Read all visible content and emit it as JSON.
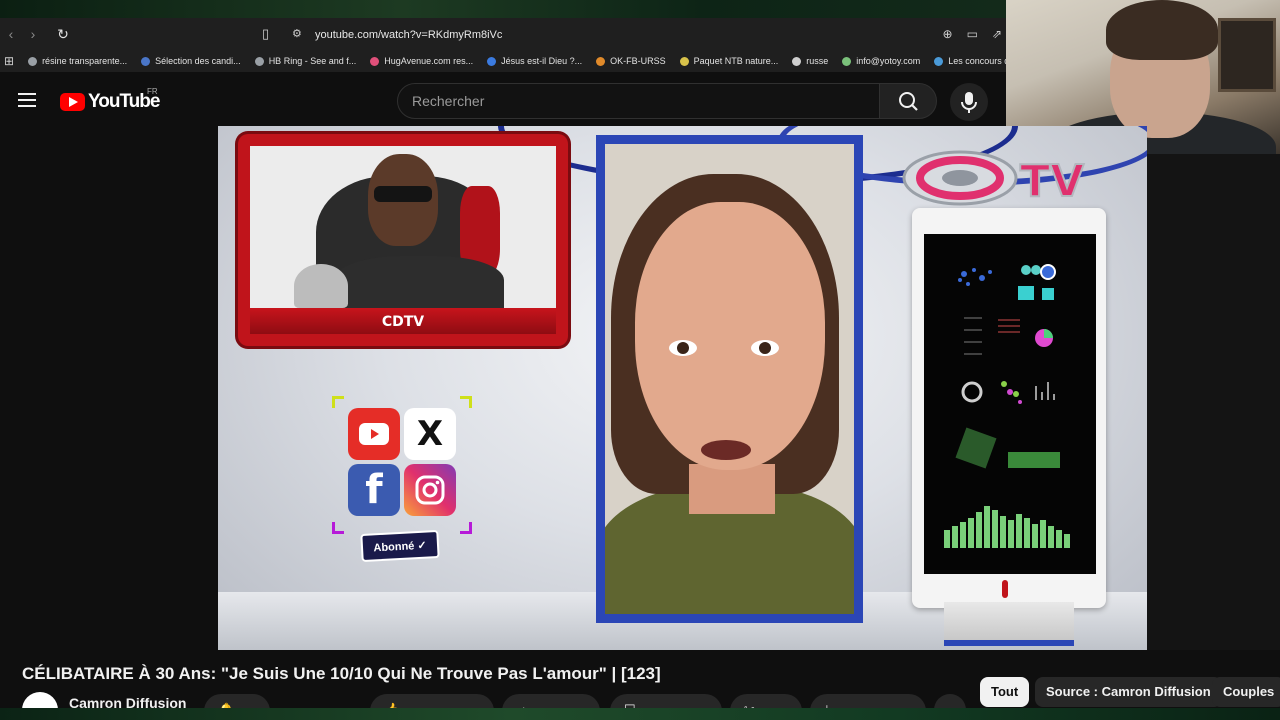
{
  "browser": {
    "url": "youtube.com/watch?v=RKdmyRm8iVc",
    "bookmarks": [
      {
        "label": "résine transparente...",
        "color": "#9aa0a6"
      },
      {
        "label": "Sélection des candi...",
        "color": "#4a76c8"
      },
      {
        "label": "HB Ring - See and f...",
        "color": "#9aa0a6"
      },
      {
        "label": "HugAvenue.com res...",
        "color": "#e0507a"
      },
      {
        "label": "Jésus est-il Dieu ?...",
        "color": "#3b7be0"
      },
      {
        "label": "OK-FB-URSS",
        "color": "#e08a2a"
      },
      {
        "label": "Paquet NTB nature...",
        "color": "#d8c24a"
      },
      {
        "label": "russe",
        "color": "#cfcfcf"
      },
      {
        "label": "info@yotoy.com",
        "color": "#7ac07a"
      },
      {
        "label": "Les concours d'au",
        "color": "#4a9ad8"
      }
    ]
  },
  "youtube": {
    "logo_text": "YouTube",
    "country": "FR",
    "search_placeholder": "Rechercher",
    "video": {
      "host_label": "CDTV",
      "subscribe_label": "Abonné ✓",
      "brand_label": "TV"
    },
    "title": "CÉLIBATAIRE À 30 Ans: \"Je Suis Une 10/10 Qui Ne Trouve Pas L'amour\" | [123]",
    "channel": "Camron Diffusion",
    "chips": [
      {
        "label": "Tout",
        "active": true
      },
      {
        "label": "Source : Camron Diffusion",
        "active": false
      },
      {
        "label": "Couples",
        "active": false
      }
    ]
  },
  "colors": {
    "youtube_red": "#ff0000",
    "cdtv_red": "#c0141b",
    "frame_blue": "#2b46b6"
  }
}
